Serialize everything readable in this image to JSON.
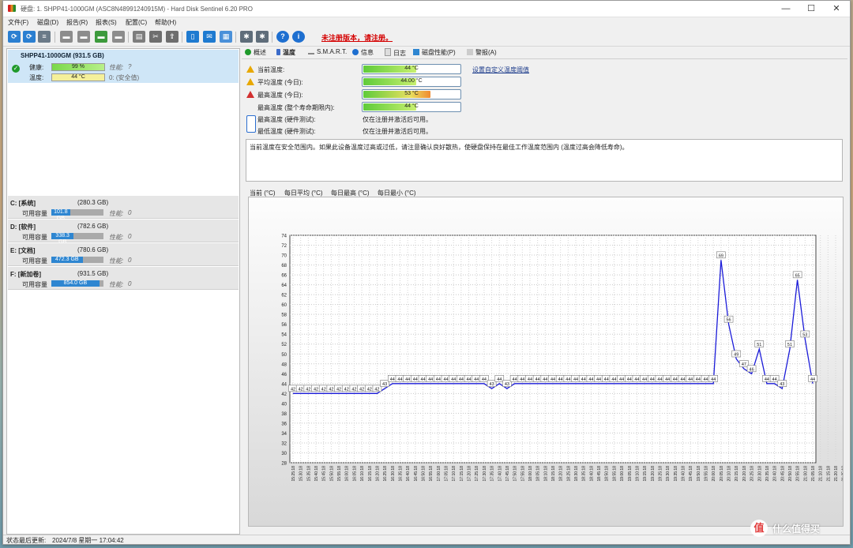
{
  "window": {
    "title": "硬盘: 1. SHPP41-1000GM (ASC8N48991240915M) - Hard Disk Sentinel 6.20 PRO",
    "controls": {
      "minimize": "—",
      "maximize": "☐",
      "close": "✕"
    }
  },
  "menu": [
    "文件(F)",
    "磁盘(D)",
    "报告(R)",
    "报表(S)",
    "配置(C)",
    "帮助(H)"
  ],
  "toolbar": {
    "buttons": [
      "refresh-icon",
      "refresh-all-icon",
      "list-icon",
      "disk-icon",
      "disk-icon",
      "disk-icon",
      "disk-icon",
      "print-icon",
      "tools-icon",
      "export-icon",
      "doc-icon",
      "mail-icon",
      "report-icon",
      "settings-icon",
      "settings-icon",
      "help-icon",
      "info-icon"
    ],
    "unregistered_notice": "未注册版本，请注册。"
  },
  "left": {
    "disk": {
      "title": "SHPP41-1000GM (931.5 GB)",
      "health_label": "健康:",
      "health_value": "99 %",
      "health_pct": 99,
      "perf_label": "性能:",
      "perf_value": "?",
      "temp_label": "温度:",
      "temp_value": "44 °C",
      "temp_note": "0: (安全值)"
    },
    "volumes": [
      {
        "name": "C: [系统]",
        "size": "(280.3 GB)",
        "free_label": "可用容量",
        "free_value": "101.8 GB",
        "free_pct": 36,
        "perf_label": "性能:",
        "perf_value": "0"
      },
      {
        "name": "D: [软件]",
        "size": "(782.6 GB)",
        "free_label": "可用容量",
        "free_value": "338.3 GB",
        "free_pct": 43,
        "perf_label": "性能:",
        "perf_value": "0"
      },
      {
        "name": "E: [文档]",
        "size": "(780.6 GB)",
        "free_label": "可用容量",
        "free_value": "472.3 GB",
        "free_pct": 60,
        "perf_label": "性能:",
        "perf_value": "0"
      },
      {
        "name": "F: [新加卷]",
        "size": "(931.5 GB)",
        "free_label": "可用容量",
        "free_value": "854.0 GB",
        "free_pct": 92,
        "perf_label": "性能:",
        "perf_value": "0"
      }
    ]
  },
  "status": {
    "label": "状态最后更新:",
    "value": "2024/7/8 星期一 17:04:42"
  },
  "tabs": [
    {
      "label": "概述",
      "color": "#1f9a2b"
    },
    {
      "label": "温度",
      "color": "#3b6bc9"
    },
    {
      "label": "S.M.A.R.T.",
      "color": "#888888"
    },
    {
      "label": "信息",
      "color": "#1e6fd0"
    },
    {
      "label": "日志",
      "color": "#999999"
    },
    {
      "label": "磁盘性能(P)",
      "color": "#2e86d1"
    },
    {
      "label": "警报(A)",
      "color": "#bbbbbb"
    }
  ],
  "temps": [
    {
      "label": "当前温度:",
      "value": "44 °C",
      "fill": 0.55,
      "warn": "yellow"
    },
    {
      "label": "平均温度 (今日):",
      "value": "44.00 °C",
      "fill": 0.55,
      "warn": "yellow"
    },
    {
      "label": "最高温度 (今日):",
      "value": "53 °C",
      "fill": 0.7,
      "warn": "red"
    },
    {
      "label": "最高温度 (整个寿命期限内):",
      "value": "44 °C",
      "fill": 0.55,
      "warn": ""
    },
    {
      "label": "最高温度 (硬件测试):",
      "value": "仅在注册并激活后可用。",
      "fill": 0,
      "warn": ""
    },
    {
      "label": "最低温度 (硬件测试):",
      "value": "仅在注册并激活后可用。",
      "fill": 0,
      "warn": ""
    }
  ],
  "temp_link": "设置自定义温度阈值",
  "message": "当前温度在安全范围内。如果此设备温度过高或过低，请注意确认良好散热，使硬盘保持在最佳工作温度范围内 (温度过高会降低寿命)。",
  "chart_tabs": [
    "当前 (°C)",
    "每日平均 (°C)",
    "每日最高 (°C)",
    "每日最小 (°C)"
  ],
  "chart_data": {
    "type": "line",
    "ylim": [
      28,
      74
    ],
    "yticks": [
      74,
      72,
      70,
      68,
      66,
      64,
      62,
      60,
      58,
      56,
      54,
      52,
      50,
      48,
      46,
      44,
      42,
      40,
      38,
      36,
      34,
      32,
      30,
      28
    ],
    "x": [
      "15:25:18",
      "15:30:18",
      "15:35:18",
      "15:40:18",
      "15:45:18",
      "15:50:18",
      "15:55:18",
      "16:00:18",
      "16:05:18",
      "16:10:18",
      "16:15:18",
      "16:20:18",
      "16:25:18",
      "16:30:18",
      "16:35:18",
      "16:40:18",
      "16:45:18",
      "16:50:18",
      "16:55:18",
      "17:00:18",
      "17:05:18",
      "17:10:18",
      "17:15:18",
      "17:20:18",
      "17:25:18",
      "17:30:18",
      "17:35:18",
      "17:40:18",
      "17:45:18",
      "17:50:18",
      "17:55:18",
      "18:00:18",
      "18:05:18",
      "18:10:18",
      "18:15:18",
      "18:20:18",
      "18:25:18",
      "18:30:18",
      "18:35:18",
      "18:40:18",
      "18:45:18",
      "18:50:18",
      "18:55:18",
      "19:00:18",
      "19:05:18",
      "19:10:18",
      "19:15:18",
      "19:20:18",
      "19:25:18",
      "19:30:18",
      "19:35:18",
      "19:40:18",
      "19:45:18",
      "19:50:18",
      "19:55:18",
      "20:00:18",
      "20:05:18",
      "20:10:18",
      "20:15:18",
      "20:20:18",
      "20:25:18",
      "20:30:18",
      "20:35:18",
      "20:40:18",
      "20:45:18",
      "20:50:18",
      "20:55:18",
      "21:00:18",
      "21:05:18",
      "21:10:18",
      "21:15:18",
      "21:20:18",
      "21:25:18",
      "21:30:18",
      "21:35:18"
    ],
    "values": [
      42,
      42,
      42,
      42,
      42,
      42,
      42,
      42,
      42,
      42,
      42,
      42,
      43,
      44,
      44,
      44,
      44,
      44,
      44,
      44,
      44,
      44,
      44,
      44,
      44,
      44,
      43,
      44,
      43,
      44,
      44,
      44,
      44,
      44,
      44,
      44,
      44,
      44,
      44,
      44,
      44,
      44,
      44,
      44,
      44,
      44,
      44,
      44,
      44,
      44,
      44,
      44,
      44,
      44,
      44,
      44,
      69,
      56,
      49,
      47,
      46,
      51,
      44,
      44,
      43,
      51,
      65,
      53,
      44
    ],
    "grid": true
  }
}
